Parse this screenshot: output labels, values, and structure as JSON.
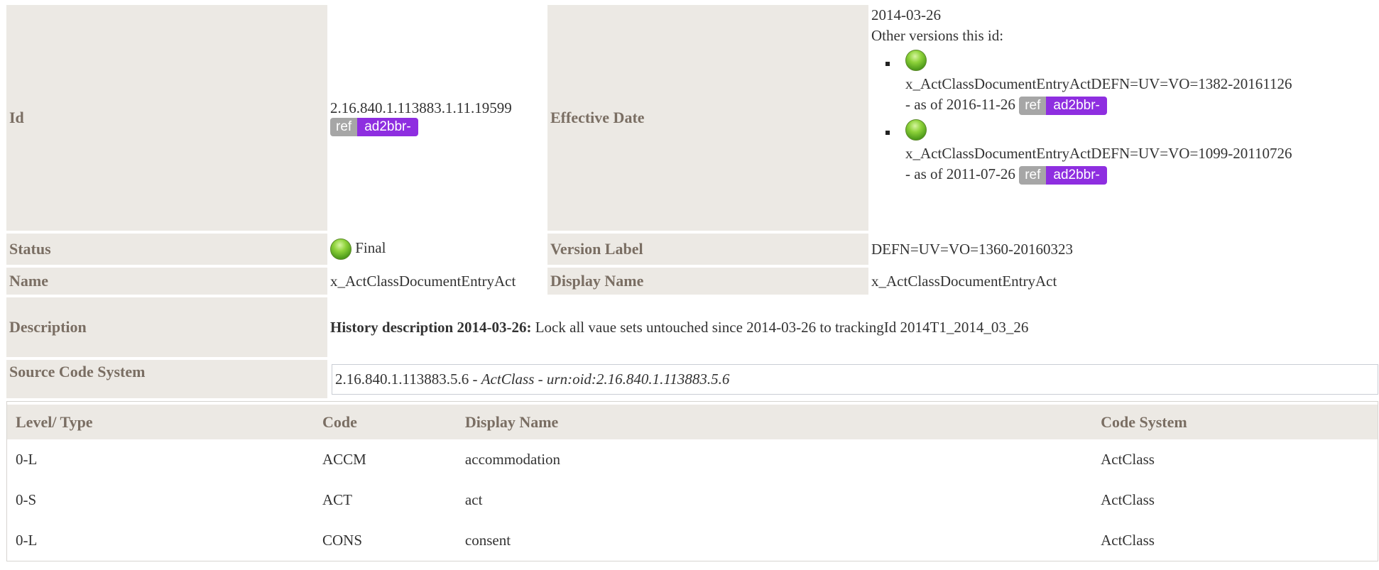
{
  "meta": {
    "id": {
      "label": "Id",
      "value": "2.16.840.1.113883.1.11.19599",
      "ref": "ref",
      "project": "ad2bbr-"
    },
    "effective_date": {
      "label": "Effective Date",
      "value": "2014-03-26",
      "other_versions_label": "Other versions this id:",
      "versions": [
        {
          "name": "x_ActClassDocumentEntryActDEFN=UV=VO=1382-20161126",
          "as_of": "- as of 2016-11-26",
          "ref": "ref",
          "project": "ad2bbr-",
          "status_color": "#7cc52f"
        },
        {
          "name": "x_ActClassDocumentEntryActDEFN=UV=VO=1099-20110726",
          "as_of": "- as of 2011-07-26",
          "ref": "ref",
          "project": "ad2bbr-",
          "status_color": "#7cc52f"
        }
      ]
    },
    "status": {
      "label": "Status",
      "value": "Final",
      "status_icon": "green-ball-icon"
    },
    "version_label": {
      "label": "Version Label",
      "value": "DEFN=UV=VO=1360-20160323"
    },
    "name": {
      "label": "Name",
      "value": "x_ActClassDocumentEntryAct"
    },
    "display_name": {
      "label": "Display Name",
      "value": "x_ActClassDocumentEntryAct"
    },
    "description": {
      "label": "Description",
      "prefix": "History description 2014-03-26:",
      "text": " Lock all vaue sets untouched since 2014-03-26 to trackingId 2014T1_2014_03_26"
    },
    "source_code_system": {
      "label": "Source Code System",
      "oid": "2.16.840.1.113883.5.6",
      "sep1": " - ",
      "name": "ActClass",
      "sep2": " - ",
      "urn": "urn:oid:2.16.840.1.113883.5.6"
    }
  },
  "concepts": {
    "headers": [
      "Level/ Type",
      "Code",
      "Display Name",
      "Code System"
    ],
    "rows": [
      [
        "0-L",
        "ACCM",
        "accommodation",
        "ActClass"
      ],
      [
        "0-S",
        "ACT",
        "act",
        "ActClass"
      ],
      [
        "0-L",
        "CONS",
        "consent",
        "ActClass"
      ]
    ]
  },
  "colors": {
    "label_bg": "#ece9e4",
    "label_text": "#7a6e63",
    "project_badge": "#8e2ee0",
    "ref_badge": "#a6a6a6"
  }
}
